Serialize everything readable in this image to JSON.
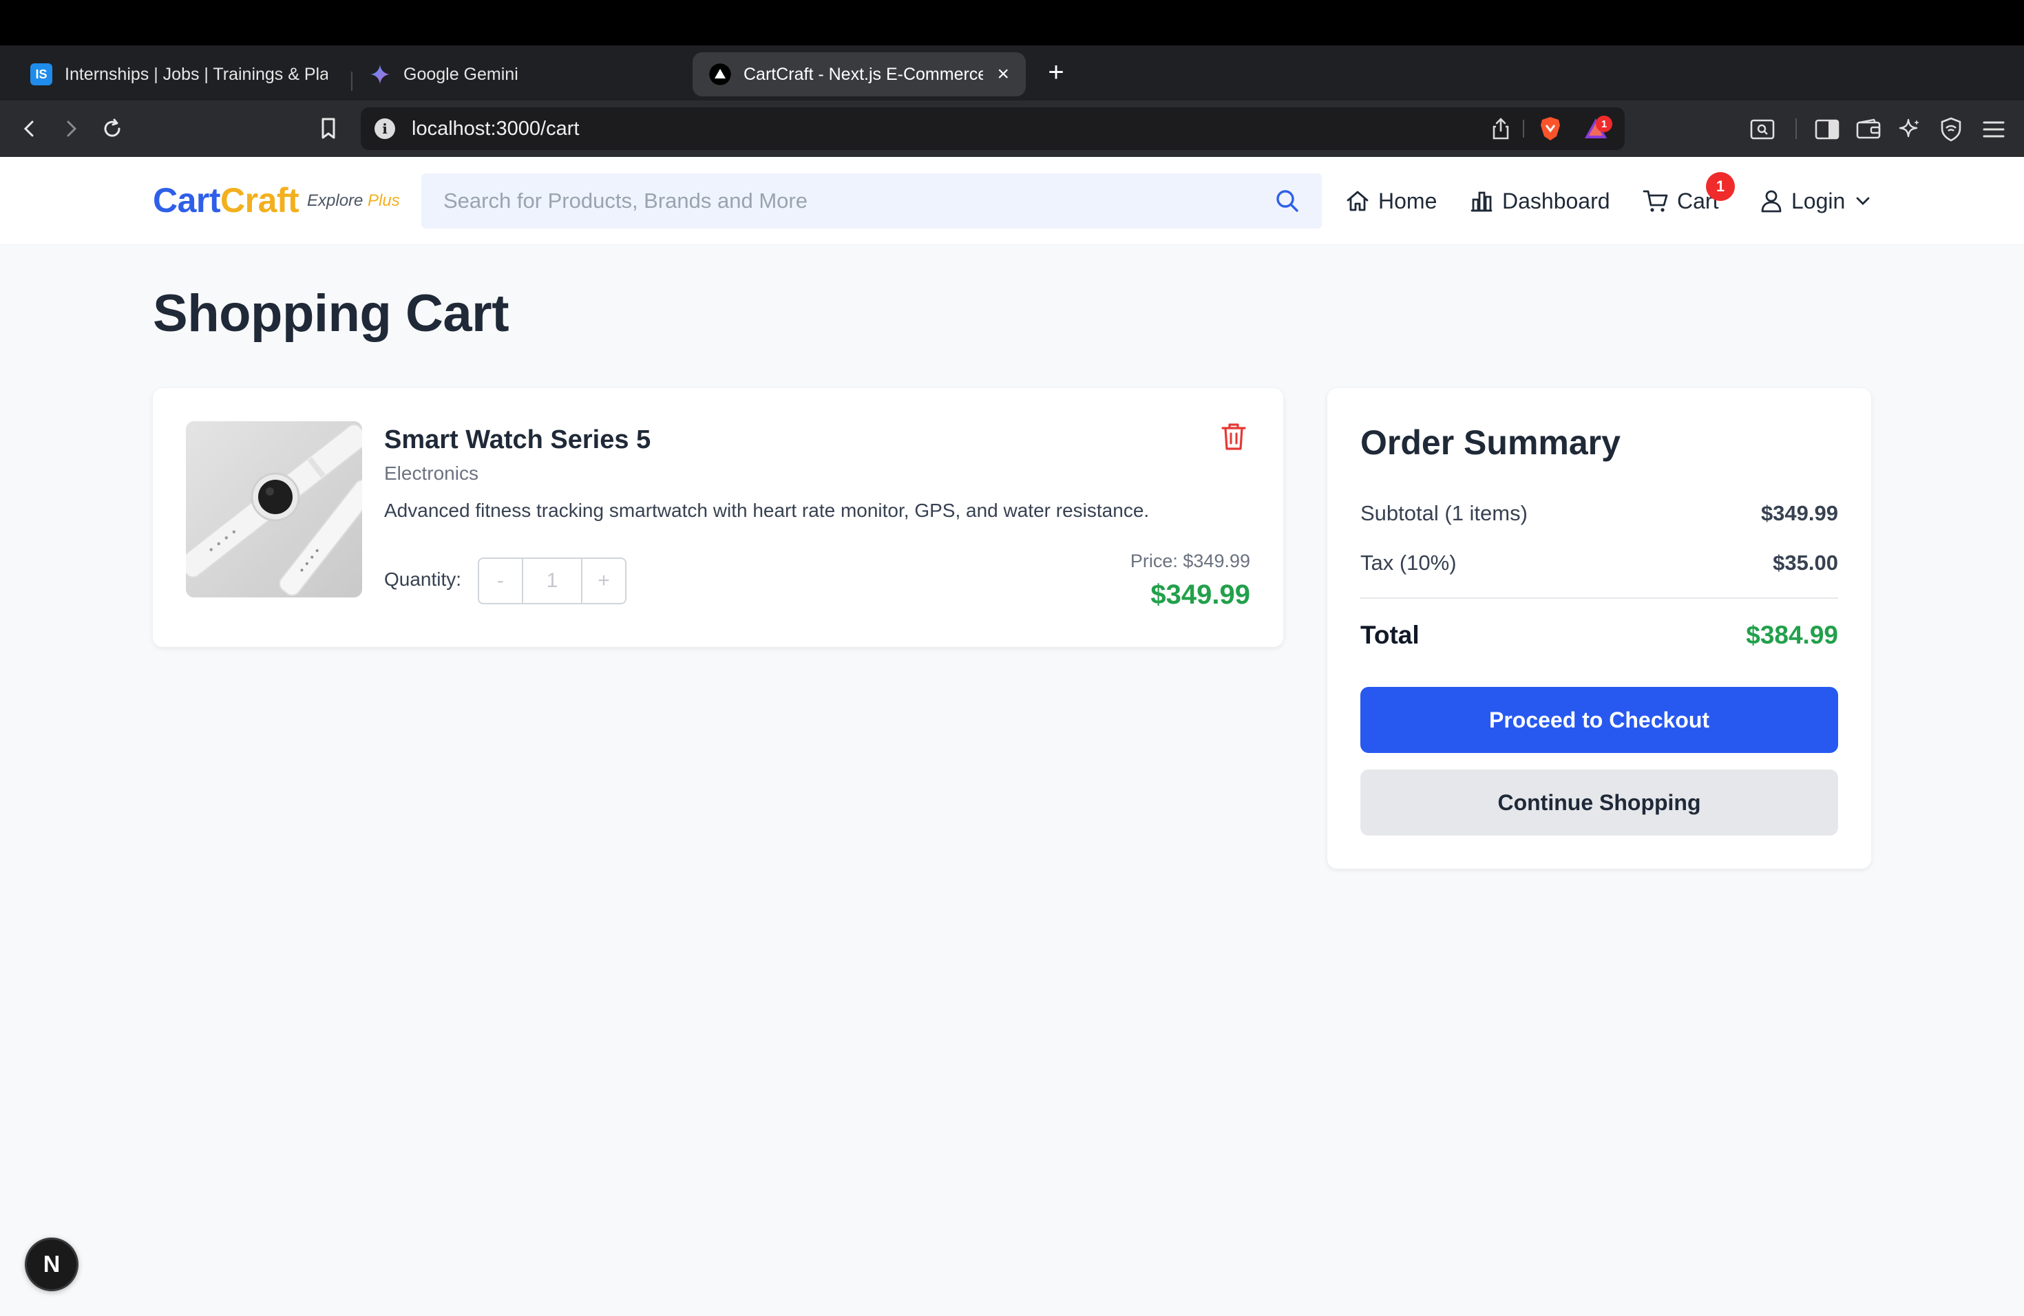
{
  "browser": {
    "tabs": [
      {
        "label": "Internships | Jobs | Trainings & Placements",
        "favicon": "IS",
        "icon": "internshala-favicon-icon"
      },
      {
        "label": "Google Gemini",
        "favicon": "",
        "icon": "gemini-sparkle-icon"
      },
      {
        "label": "CartCraft - Next.js E-Commerce",
        "favicon": "",
        "icon": "vercel-triangle-icon",
        "active": true
      }
    ],
    "new_tab_label": "+",
    "close_tab_label": "×",
    "url": "localhost:3000/cart",
    "shields_badge_count": "1"
  },
  "header": {
    "logo_part1": "Cart",
    "logo_part2": "Craft",
    "tagline_part1": "Explore ",
    "tagline_part2": "Plus",
    "search_placeholder": "Search for Products, Brands and More",
    "nav": {
      "home": "Home",
      "dashboard": "Dashboard",
      "cart": "Cart",
      "cart_count": "1",
      "login": "Login"
    }
  },
  "page": {
    "title": "Shopping Cart"
  },
  "cart_items": [
    {
      "name": "Smart Watch Series 5",
      "category": "Electronics",
      "description": "Advanced fitness tracking smartwatch with heart rate monitor, GPS, and water resistance.",
      "quantity_label": "Quantity:",
      "quantity": "1",
      "minus_label": "-",
      "plus_label": "+",
      "price_label": "Price: $349.99",
      "line_total": "$349.99"
    }
  ],
  "summary": {
    "title": "Order Summary",
    "subtotal_label": "Subtotal (1 items)",
    "subtotal_value": "$349.99",
    "tax_label": "Tax (10%)",
    "tax_value": "$35.00",
    "total_label": "Total",
    "total_value": "$384.99",
    "checkout_label": "Proceed to Checkout",
    "continue_label": "Continue Shopping"
  },
  "dev": {
    "next_badge": "N"
  },
  "colors": {
    "brand_blue": "#2f5fe8",
    "brand_yellow": "#f2b01e",
    "price_green": "#22a04b",
    "primary_button": "#2759f0",
    "danger_red": "#e53935"
  }
}
